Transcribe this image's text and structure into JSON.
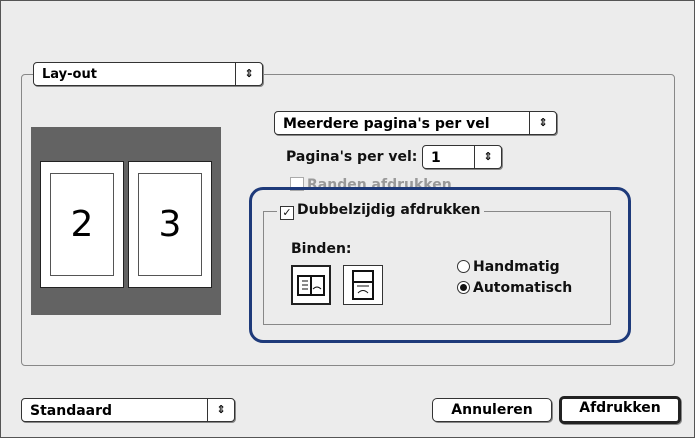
{
  "layout_popup": {
    "value": "Lay-out"
  },
  "pages_mode_popup": {
    "value": "Meerdere pagina's per vel"
  },
  "pages_per_sheet": {
    "label": "Pagina's per vel:",
    "value": "1"
  },
  "borders": {
    "label": "Randen afdrukken",
    "checked": false,
    "enabled": false
  },
  "duplex": {
    "label": "Dubbelzijdig afdrukken",
    "checked": true
  },
  "binding": {
    "label": "Binden:"
  },
  "mode_radios": [
    {
      "label": "Handmatig",
      "selected": false
    },
    {
      "label": "Automatisch",
      "selected": true
    }
  ],
  "preview": {
    "page_left": "2",
    "page_right": "3"
  },
  "presets_popup": {
    "value": "Standaard"
  },
  "buttons": {
    "cancel": "Annuleren",
    "print": "Afdrukken"
  },
  "colors": {
    "highlight": "#1e3a7a",
    "preview_bg": "#636363"
  }
}
